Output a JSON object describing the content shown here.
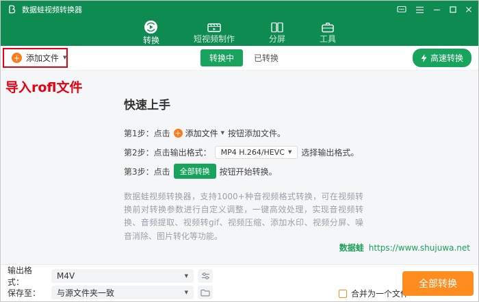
{
  "titlebar": {
    "title": "数据蛙视频转换器"
  },
  "tabs": [
    {
      "label": "转换",
      "active": true
    },
    {
      "label": "短视频制作",
      "active": false
    },
    {
      "label": "分屏",
      "active": false
    },
    {
      "label": "工具",
      "active": false
    }
  ],
  "toolbar": {
    "add_file": "添加文件",
    "converting": "转换中",
    "converted": "已转换",
    "high_speed": "高速转换"
  },
  "annotation": {
    "text": "导入rofl文件"
  },
  "content": {
    "title": "快速上手",
    "steps": [
      {
        "prefix": "第1步：点击",
        "button": "添加文件",
        "suffix": "按钮添加文件。"
      },
      {
        "prefix": "第2步：点击输出格式：",
        "button": "MP4 H.264/HEVC",
        "suffix": "选择输出格式。"
      },
      {
        "prefix": "第3步：点击",
        "button": "全部转换",
        "suffix": "按钮开始转换。"
      }
    ],
    "description": "数据蛙视频转换器，支持1000+种音视频格式转换，可在视频转换前对转换参数进行自定义调整，一键高效处理，实现音视频转换、音频提取、视频转gif、视频压缩、添加水印、视频分屏、噪音消除、图片转化等功能。",
    "brand": "数据蛙",
    "link": "https://www.shujuwa.net"
  },
  "footer": {
    "output_format_label": "输出格式：",
    "output_format_value": "M4V",
    "save_to_label": "保存至：",
    "save_to_value": "与源文件夹一致",
    "merge_label": "合并为一个文件",
    "merge_checked": false,
    "convert_all": "全部转换"
  },
  "icons": {
    "plus": "+",
    "caret_down": "▼"
  },
  "colors": {
    "green-dark": "#0e8b51",
    "green": "#18a45c",
    "orange": "#ff8c1f",
    "annotation-red": "#e60012",
    "link-green": "#1ba05b"
  }
}
